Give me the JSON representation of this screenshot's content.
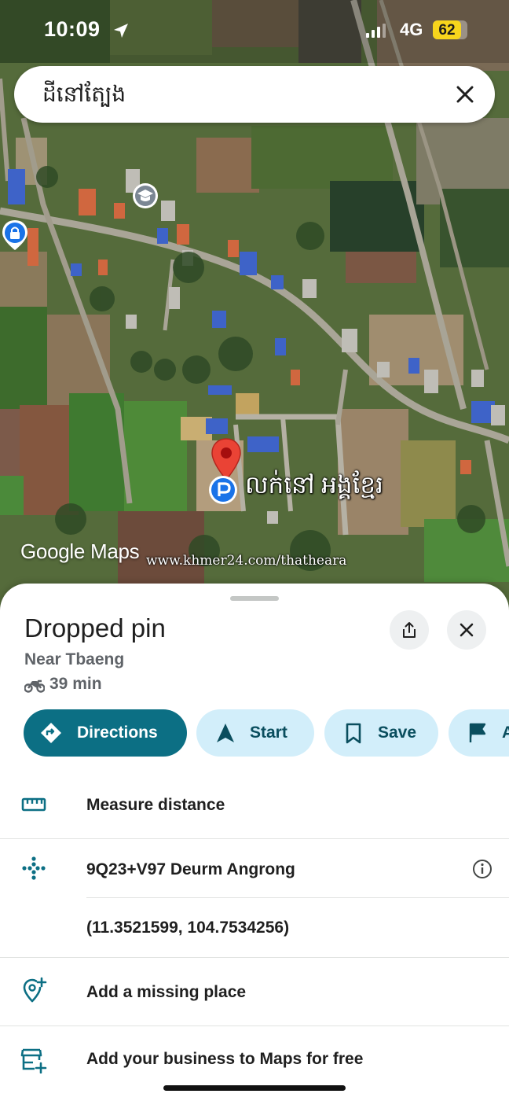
{
  "status_bar": {
    "time": "10:09",
    "network": "4G",
    "battery": "62",
    "battery_level": 0.62,
    "location_icon": "location-arrow-icon",
    "signal_icon": "cellular-signal-icon"
  },
  "search": {
    "query": "ដីនៅតែ្បង",
    "clear_icon": "close-icon"
  },
  "map": {
    "pin_label": "លក់នៅ អង្គខ្មែរ",
    "logo": "Google Maps",
    "watermark": "www.khmer24.com/thatheara",
    "pin_icon": "red-map-pin-icon",
    "pin_badge_icon": "parking-badge-icon",
    "poi_icons": [
      "school-icon",
      "shopping-lock-icon"
    ]
  },
  "place": {
    "title": "Dropped pin",
    "subtitle": "Near Tbaeng",
    "travel_time": "39 min",
    "travel_icon": "motorbike-icon",
    "share_icon": "share-icon",
    "close_icon": "close-icon"
  },
  "actions": [
    {
      "label": "Directions",
      "icon": "directions-diamond-icon",
      "primary": true
    },
    {
      "label": "Start",
      "icon": "navigation-arrow-icon",
      "primary": false
    },
    {
      "label": "Save",
      "icon": "bookmark-icon",
      "primary": false
    },
    {
      "label": "A",
      "icon": "flag-icon",
      "primary": false
    }
  ],
  "rows": {
    "measure": {
      "label": "Measure distance",
      "icon": "ruler-icon"
    },
    "plus_code": {
      "label": "9Q23+V97 Deurm Angrong",
      "icon": "plus-code-icon",
      "info_icon": "info-icon"
    },
    "coordinates": {
      "label": "(11.3521599, 104.7534256)"
    },
    "missing_place": {
      "label": "Add a missing place",
      "icon": "add-location-icon"
    },
    "business": {
      "label": "Add your business to Maps for free",
      "icon": "add-business-icon"
    }
  },
  "colors": {
    "primary": "#0c6f84",
    "chip": "#d2eefa",
    "chip_text": "#0a4e5e",
    "pin": "#ea4335",
    "badge": "#1a73e8",
    "battery": "#f7d51c"
  }
}
